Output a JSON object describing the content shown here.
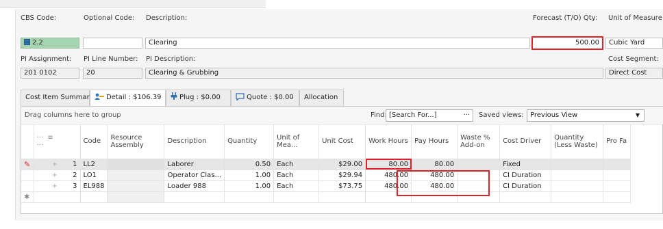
{
  "header": {
    "cbs_code_label": "CBS Code:",
    "cbs_code_value": "2.2",
    "optional_code_label": "Optional Code:",
    "optional_code_value": "",
    "description_label": "Description:",
    "description_value": "Clearing",
    "forecast_label": "Forecast (T/O) Qty:",
    "forecast_value": "500.00",
    "uom_label": "Unit of Measure",
    "uom_value": "Cubic Yard",
    "pi_assignment_label": "PI Assignment:",
    "pi_assignment_value": "201 0102",
    "pi_line_label": "PI Line Number:",
    "pi_line_value": "20",
    "pi_desc_label": "PI Description:",
    "pi_desc_value": "Clearing & Grubbing",
    "cost_segment_label": "Cost Segment:",
    "cost_segment_value": "Direct Cost"
  },
  "tabs": [
    {
      "label": "Cost Item Summary"
    },
    {
      "label": "Detail : $106.39"
    },
    {
      "label": "Plug : $0.00"
    },
    {
      "label": "Quote : $0.00"
    },
    {
      "label": "Allocation"
    }
  ],
  "toolbar": {
    "group_hint": "Drag columns here to group",
    "find_label": "Find:",
    "find_placeholder": "[Search For...]",
    "find_more": "···",
    "saved_views_label": "Saved views:",
    "saved_views_value": "Previous View"
  },
  "columns": {
    "sel": "··· ≡\n···",
    "code": "Code",
    "resource": "Resource Assembly",
    "description": "Description",
    "quantity": "Quantity",
    "unit": "Unit of Mea...",
    "unit_cost": "Unit Cost",
    "work_hours": "Work Hours",
    "pay_hours": "Pay Hours",
    "waste": "Waste % Add-on",
    "cost_driver": "Cost Driver",
    "qty_less": "Quantity (Less Waste)",
    "pro": "Pro Fa"
  },
  "rows": [
    {
      "num": "1",
      "code": "LL2",
      "resource": "",
      "description": "Laborer",
      "quantity": "0.50",
      "unit": "Each",
      "unit_cost": "$29.00",
      "work_hours": "80.00",
      "pay_hours": "80.00",
      "waste": "",
      "cost_driver": "Fixed",
      "qty_less": "",
      "pro": ""
    },
    {
      "num": "2",
      "code": "LO1",
      "resource": "",
      "description": "Operator Clas...",
      "quantity": "1.00",
      "unit": "Each",
      "unit_cost": "$29.94",
      "work_hours": "480.00",
      "pay_hours": "480.00",
      "waste": "",
      "cost_driver": "CI Duration",
      "qty_less": "",
      "pro": ""
    },
    {
      "num": "3",
      "code": "EL988",
      "resource": "",
      "description": "Loader 988",
      "quantity": "1.00",
      "unit": "Each",
      "unit_cost": "$73.75",
      "work_hours": "480.00",
      "pay_hours": "480.00",
      "waste": "",
      "cost_driver": "CI Duration",
      "qty_less": "",
      "pro": ""
    }
  ],
  "colors": {
    "highlight": "#e0202a",
    "cbs_green": "#a6d3b0",
    "accent_blue": "#2f6fa6"
  }
}
